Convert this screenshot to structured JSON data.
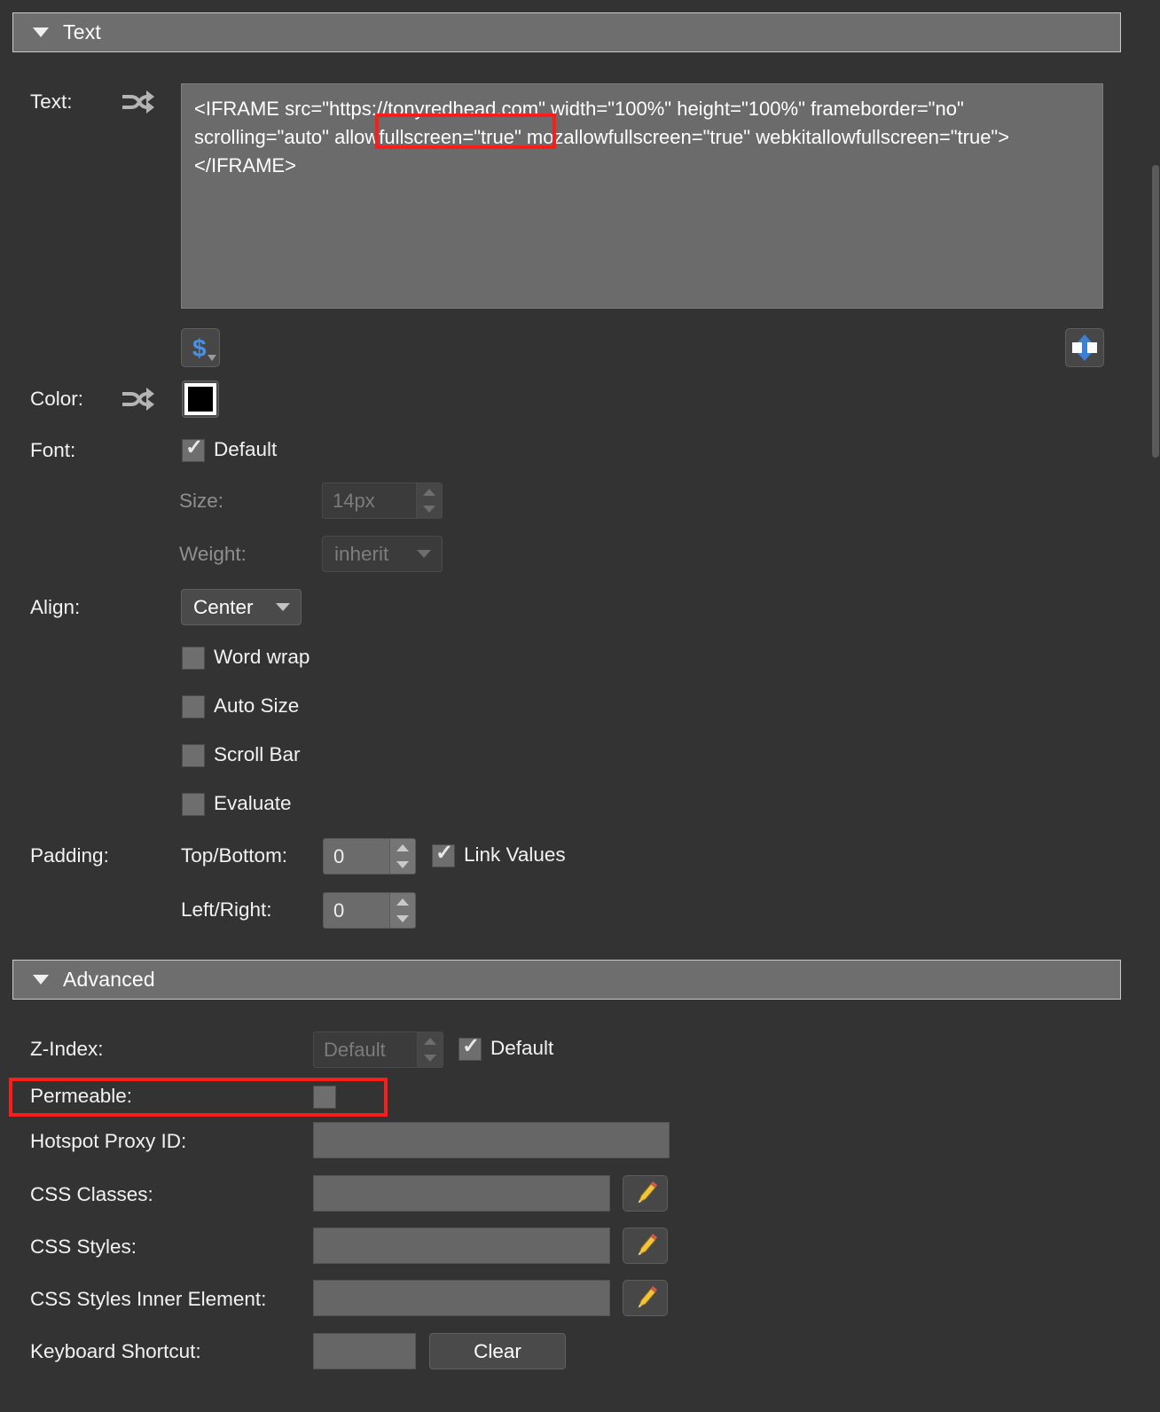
{
  "sections": {
    "text": {
      "title": "Text",
      "expanded": true,
      "collapse_icon": "triangle-down-icon"
    },
    "advanced": {
      "title": "Advanced",
      "expanded": true,
      "collapse_icon": "triangle-down-icon"
    }
  },
  "text_section": {
    "text_label": "Text:",
    "binding_icon": "shuffle-binding-icon",
    "text_value": "<IFRAME src=\"https://tonyredhead.com\" width=\"100%\" height=\"100%\" frameborder=\"no\" scrolling=\"auto\" allowfullscreen=\"true\" mozallowfullscreen=\"true\" webkitallowfullscreen=\"true\"></IFRAME>",
    "variable_button": {
      "icon": "dollar-sign-icon",
      "dropdown_icon": "caret-down-icon"
    },
    "expand_button": {
      "icon": "expand-vertical-arrows-icon"
    },
    "color_label": "Color:",
    "color_binding_icon": "shuffle-binding-icon",
    "color_value": "#000000",
    "font_label": "Font:",
    "font_default_label": "Default",
    "font_default_checked": true,
    "size_label": "Size:",
    "size_value": "14px",
    "size_enabled": false,
    "weight_label": "Weight:",
    "weight_value": "inherit",
    "weight_enabled": false,
    "align_label": "Align:",
    "align_value": "Center",
    "checkboxes": [
      {
        "label": "Word wrap",
        "checked": false
      },
      {
        "label": "Auto Size",
        "checked": false
      },
      {
        "label": "Scroll Bar",
        "checked": false
      },
      {
        "label": "Evaluate",
        "checked": false
      }
    ],
    "padding_label": "Padding:",
    "padding_top_bottom_label": "Top/Bottom:",
    "padding_top_bottom_value": "0",
    "padding_left_right_label": "Left/Right:",
    "padding_left_right_value": "0",
    "link_values_label": "Link Values",
    "link_values_checked": true
  },
  "advanced_section": {
    "z_index_label": "Z-Index:",
    "z_index_value": "Default",
    "z_index_enabled": false,
    "z_index_default_label": "Default",
    "z_index_default_checked": true,
    "permeable_label": "Permeable:",
    "permeable_checked": false,
    "hotspot_proxy_label": "Hotspot Proxy ID:",
    "hotspot_proxy_value": "",
    "css_classes_label": "CSS Classes:",
    "css_classes_value": "",
    "css_styles_label": "CSS Styles:",
    "css_styles_value": "",
    "css_styles_inner_label": "CSS Styles Inner Element:",
    "css_styles_inner_value": "",
    "keyboard_shortcut_label": "Keyboard Shortcut:",
    "keyboard_shortcut_value": "",
    "clear_button_label": "Clear",
    "edit_icon": "pencil-edit-icon"
  },
  "annotations": {
    "highlight_color": "#fb1c1c",
    "boxes": [
      {
        "name": "scrolling-attribute-highlight",
        "target": "scrolling=\"auto\""
      },
      {
        "name": "permeable-row-highlight",
        "target": "Permeable:"
      }
    ]
  }
}
